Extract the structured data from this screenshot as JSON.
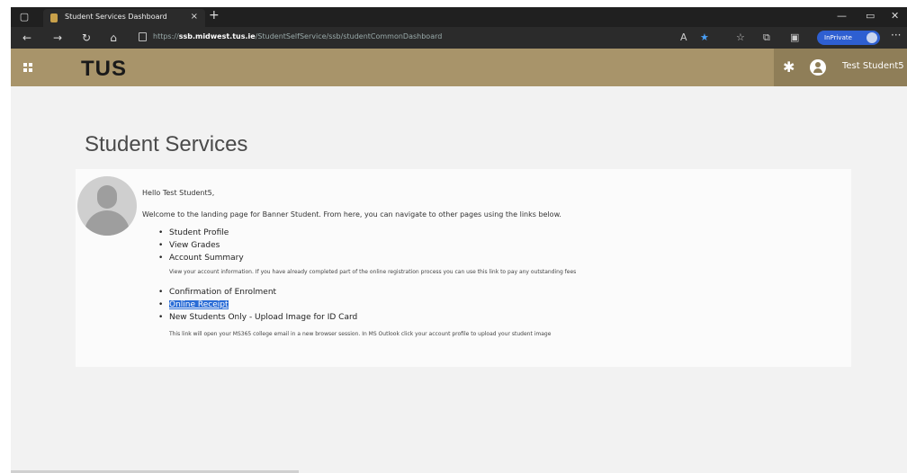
{
  "browser": {
    "tab_title": "Student Services Dashboard",
    "new_tab_glyph": "+",
    "url_scheme": "https://",
    "url_host": "ssb.midwest.tus.ie",
    "url_path": "/StudentSelfService/ssb/studentCommonDashboard",
    "inprivate_label": "InPrivate",
    "icons": [
      "back-icon",
      "forward-icon",
      "refresh-icon",
      "home-icon",
      "lock-icon",
      "read-aloud-icon",
      "favorite-star-icon",
      "favorites-icon",
      "collections-icon",
      "split-screen-icon",
      "more-icon"
    ]
  },
  "app_header": {
    "brand": "TUS",
    "user_name": "Test Student5",
    "accent_color": "#a8946a"
  },
  "main": {
    "page_title": "Student Services",
    "greeting": "Hello Test Student5,",
    "intro": "Welcome to the landing page for Banner Student. From here, you can navigate to other pages using the links below.",
    "links": [
      {
        "label": "Student Profile",
        "description": ""
      },
      {
        "label": "View Grades",
        "description": ""
      },
      {
        "label": "Account Summary",
        "description": "View your account information. If you have already completed part of the online registration process you can use this link to pay any outstanding fees"
      },
      {
        "label": "Confirmation of Enrolment",
        "description": ""
      },
      {
        "label": "Online Receipt",
        "description": ""
      },
      {
        "label": "New Students Only - Upload Image for ID Card",
        "description": "This link will open your MS365 college email in a new browser session. In MS Outlook click your account profile to upload your student image"
      }
    ]
  }
}
